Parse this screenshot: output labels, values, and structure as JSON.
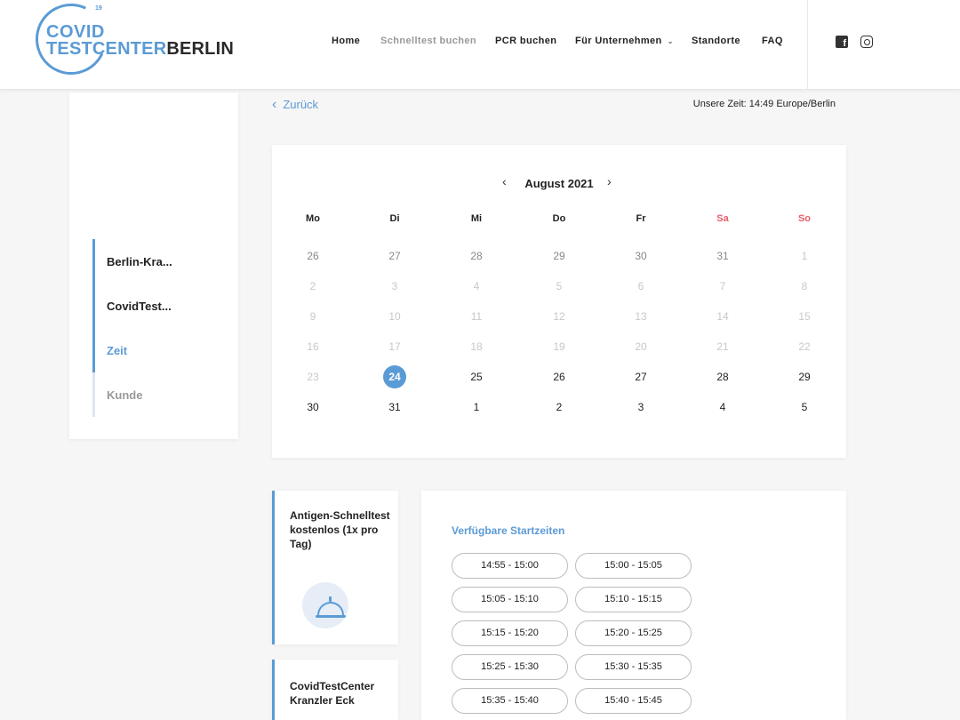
{
  "logo": {
    "sup": "19",
    "line1": "COVID",
    "line2_a": "TESTCENTER",
    "line2_b": "BERLIN"
  },
  "nav": [
    {
      "label": "Home",
      "muted": false
    },
    {
      "label": "Schnelltest buchen",
      "muted": true
    },
    {
      "label": "PCR buchen",
      "muted": false
    },
    {
      "label": "Für Unternehmen",
      "muted": false,
      "dropdown": true
    },
    {
      "label": "Standorte",
      "muted": false
    },
    {
      "label": "FAQ",
      "muted": false
    }
  ],
  "social": {
    "facebook_icon": "facebook-icon",
    "instagram_icon": "instagram-icon"
  },
  "steps": [
    {
      "label": "Berlin-Kra...",
      "state": "done"
    },
    {
      "label": "CovidTest...",
      "state": "done"
    },
    {
      "label": "Zeit",
      "state": "active"
    },
    {
      "label": "Kunde",
      "state": "pending"
    }
  ],
  "back_label": "Zurück",
  "timezone": "Unsere Zeit: 14:49 Europe/Berlin",
  "calendar": {
    "month": "August 2021",
    "weekdays": [
      "Mo",
      "Di",
      "Mi",
      "Do",
      "Fr",
      "Sa",
      "So"
    ],
    "weekend_color": "#e85c6a",
    "weeks": [
      [
        "26",
        "27",
        "28",
        "29",
        "30",
        "31",
        "1"
      ],
      [
        "2",
        "3",
        "4",
        "5",
        "6",
        "7",
        "8"
      ],
      [
        "9",
        "10",
        "11",
        "12",
        "13",
        "14",
        "15"
      ],
      [
        "16",
        "17",
        "18",
        "19",
        "20",
        "21",
        "22"
      ],
      [
        "23",
        "24",
        "25",
        "26",
        "27",
        "28",
        "29"
      ],
      [
        "30",
        "31",
        "1",
        "2",
        "3",
        "4",
        "5"
      ]
    ],
    "selected": "24"
  },
  "service": {
    "title": "Antigen-Schnelltest kostenlos (1x pro Tag)",
    "icon": "cloche-icon"
  },
  "location": {
    "title": "CovidTestCenter Kranzler Eck"
  },
  "times": {
    "title": "Verfügbare Startzeiten",
    "slots": [
      "14:55 - 15:00",
      "15:00 - 15:05",
      "15:05 - 15:10",
      "15:10 - 15:15",
      "15:15 - 15:20",
      "15:20 - 15:25",
      "15:25 - 15:30",
      "15:30 - 15:35",
      "15:35 - 15:40",
      "15:40 - 15:45"
    ]
  },
  "colors": {
    "accent": "#5b9bd5",
    "weekend": "#e85c6a",
    "text": "#222222"
  }
}
